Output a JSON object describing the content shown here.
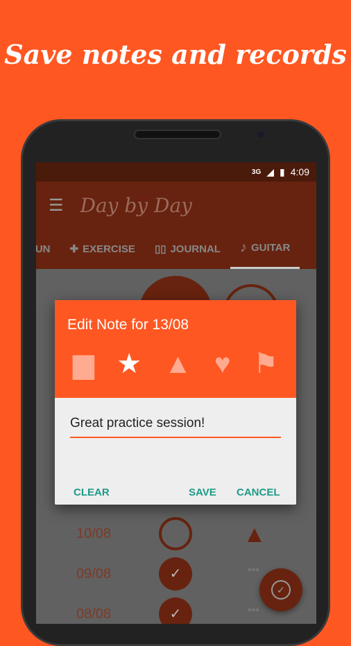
{
  "headline": "Save notes and records",
  "status": {
    "network": "3G",
    "time": "4:09"
  },
  "app": {
    "logo": "Day by Day",
    "menu_icon": "hamburger-icon"
  },
  "tabs": [
    {
      "label": "RUN"
    },
    {
      "label": "EXERCISE",
      "icon": "dumbbell-icon"
    },
    {
      "label": "JOURNAL",
      "icon": "book-icon"
    },
    {
      "label": "GUITAR",
      "icon": "music-note-icon",
      "active": true
    }
  ],
  "rows": [
    {
      "date": "10/08",
      "status": "empty",
      "note_icon": "warning-icon"
    },
    {
      "date": "09/08",
      "status": "done",
      "note_icon": "dots-icon"
    },
    {
      "date": "08/08",
      "status": "done",
      "note_icon": "dots-icon"
    }
  ],
  "dialog": {
    "title": "Edit Note for 13/08",
    "icons": [
      "comment-icon",
      "star-icon",
      "warning-icon",
      "heart-icon",
      "flag-icon"
    ],
    "selected_icon": "star-icon",
    "note_value": "Great practice session!",
    "clear": "CLEAR",
    "save": "SAVE",
    "cancel": "CANCEL"
  },
  "colors": {
    "accent": "#FF5722",
    "button_text": "#1e9a88"
  }
}
